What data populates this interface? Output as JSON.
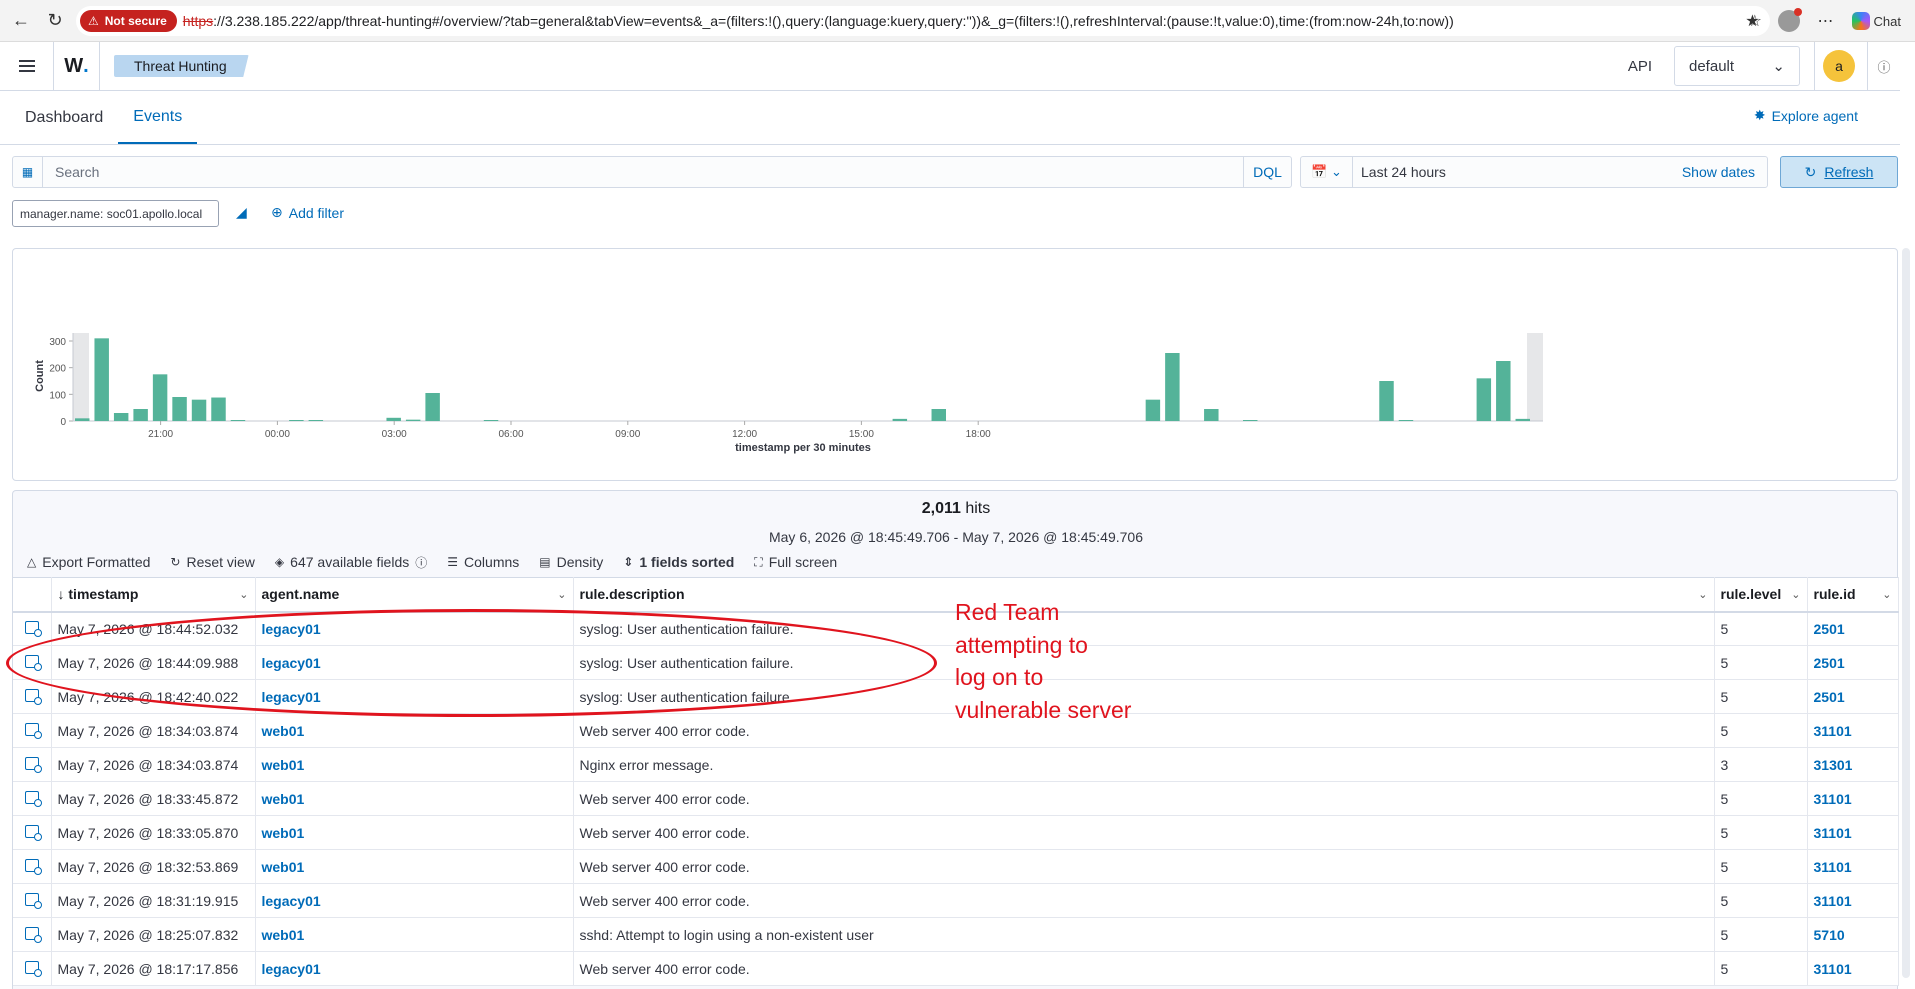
{
  "browser": {
    "not_secure": "Not secure",
    "url_scheme": "https",
    "url_rest": "://3.238.185.222/app/threat-hunting#/overview/?tab=general&tabView=events&_a=(filters:!(),query:(language:kuery,query:''))&_g=(filters:!(),refreshInterval:(pause:!t,value:0),time:(from:now-24h,to:now))",
    "chat_label": "Chat"
  },
  "header": {
    "logo": "W",
    "breadcrumb": "Threat Hunting",
    "api_label": "API",
    "tenant": "default",
    "user_initial": "a"
  },
  "tabs": [
    {
      "label": "Dashboard",
      "active": false
    },
    {
      "label": "Events",
      "active": true
    }
  ],
  "explore_agent": "Explore agent",
  "search": {
    "placeholder": "Search",
    "query_language": "DQL",
    "time_range": "Last 24 hours",
    "show_dates": "Show dates",
    "refresh": "Refresh"
  },
  "filters": {
    "active_filter": "manager.name: soc01.apollo.local",
    "add_filter": "Add filter"
  },
  "chart_data": {
    "type": "bar",
    "ylabel": "Count",
    "xlabel": "timestamp per 30 minutes",
    "ylim": [
      0,
      330
    ],
    "yticks": [
      0,
      100,
      200,
      300
    ],
    "xtick_labels": [
      "21:00",
      "00:00",
      "03:00",
      "06:00",
      "09:00",
      "12:00",
      "15:00",
      "18:00"
    ],
    "bar_interval_minutes": 30,
    "first_bar_time": "18:45",
    "partial_buckets": "first and last bars shown as grey partial-bucket bands",
    "values": [
      10,
      310,
      30,
      45,
      175,
      90,
      80,
      88,
      2,
      0,
      0,
      2,
      2,
      0,
      0,
      0,
      12,
      5,
      105,
      0,
      0,
      2,
      0,
      0,
      0,
      0,
      0,
      0,
      0,
      0,
      0,
      0,
      0,
      0,
      0,
      0,
      0,
      0,
      0,
      0,
      0,
      0,
      8,
      0,
      45,
      0,
      0,
      0,
      0,
      0,
      0,
      0,
      0,
      0,
      0,
      80,
      255,
      0,
      45,
      0,
      2,
      0,
      0,
      0,
      0,
      0,
      0,
      150,
      2,
      0,
      0,
      0,
      160,
      225,
      8
    ],
    "color": "#54b399"
  },
  "results": {
    "hits_count": "2,011",
    "hits_label": "hits",
    "range": "May 6, 2026 @ 18:45:49.706 - May 7, 2026 @ 18:45:49.706",
    "toolbar": {
      "export": "Export Formatted",
      "reset": "Reset view",
      "fields": "647 available fields",
      "columns": "Columns",
      "density": "Density",
      "sorted": "1 fields sorted",
      "fullscreen": "Full screen"
    },
    "columns": [
      "timestamp",
      "agent.name",
      "rule.description",
      "rule.level",
      "rule.id"
    ],
    "rows": [
      {
        "timestamp": "May 7, 2026 @ 18:44:52.032",
        "agent": "legacy01",
        "description": "syslog: User authentication failure.",
        "level": "5",
        "id": "2501"
      },
      {
        "timestamp": "May 7, 2026 @ 18:44:09.988",
        "agent": "legacy01",
        "description": "syslog: User authentication failure.",
        "level": "5",
        "id": "2501"
      },
      {
        "timestamp": "May 7, 2026 @ 18:42:40.022",
        "agent": "legacy01",
        "description": "syslog: User authentication failure.",
        "level": "5",
        "id": "2501"
      },
      {
        "timestamp": "May 7, 2026 @ 18:34:03.874",
        "agent": "web01",
        "description": "Web server 400 error code.",
        "level": "5",
        "id": "31101"
      },
      {
        "timestamp": "May 7, 2026 @ 18:34:03.874",
        "agent": "web01",
        "description": "Nginx error message.",
        "level": "3",
        "id": "31301"
      },
      {
        "timestamp": "May 7, 2026 @ 18:33:45.872",
        "agent": "web01",
        "description": "Web server 400 error code.",
        "level": "5",
        "id": "31101"
      },
      {
        "timestamp": "May 7, 2026 @ 18:33:05.870",
        "agent": "web01",
        "description": "Web server 400 error code.",
        "level": "5",
        "id": "31101"
      },
      {
        "timestamp": "May 7, 2026 @ 18:32:53.869",
        "agent": "web01",
        "description": "Web server 400 error code.",
        "level": "5",
        "id": "31101"
      },
      {
        "timestamp": "May 7, 2026 @ 18:31:19.915",
        "agent": "legacy01",
        "description": "Web server 400 error code.",
        "level": "5",
        "id": "31101"
      },
      {
        "timestamp": "May 7, 2026 @ 18:25:07.832",
        "agent": "web01",
        "description": "sshd: Attempt to login using a non-existent user",
        "level": "5",
        "id": "5710"
      },
      {
        "timestamp": "May 7, 2026 @ 18:17:17.856",
        "agent": "legacy01",
        "description": "Web server 400 error code.",
        "level": "5",
        "id": "31101"
      }
    ]
  },
  "annotation": {
    "lines": [
      "Red Team",
      "attempting to",
      "log on to",
      "vulnerable server"
    ],
    "color": "#e0141e"
  }
}
